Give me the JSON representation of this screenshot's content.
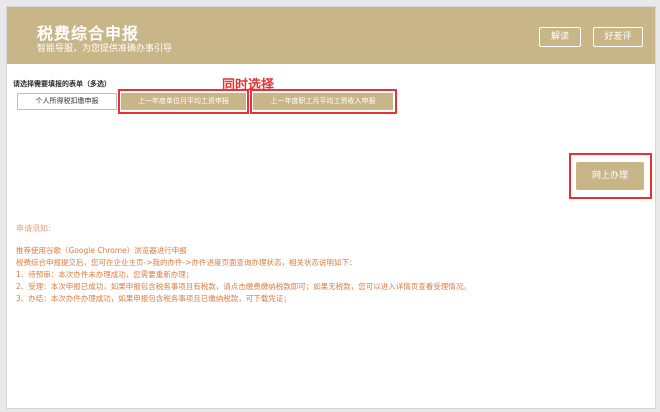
{
  "header": {
    "title": "税费综合申报",
    "subtitle": "智能导服，为您提供准确办事引导",
    "read_label": "解读",
    "rate_label": "好差评"
  },
  "annotation": {
    "text": "同时选择",
    "color": "#e63232"
  },
  "form_select": {
    "label": "请选择需要填报的表单（多选）",
    "tabs": [
      {
        "label": "个人所得税扣缴申报",
        "selected": false
      },
      {
        "label": "上一年度单位月平均工资申报",
        "selected": true
      },
      {
        "label": "上一年度职工月平均工资收入申报",
        "selected": true
      }
    ]
  },
  "actions": {
    "online_label": "网上办理"
  },
  "notice": {
    "title": "申请须知:",
    "lines": [
      "推荐使用谷歌（Google Chrome）浏览器进行申报",
      "税费综合申报提交后，您可在企业主页->我的办件->办件进度页面查询办理状态，相关状态说明如下：",
      "1、待预审：本次办件未办理成功，您需要重新办理；",
      "2、受理：本次申报已成功，如果申报包含税务事项且有税款，请点击缴费缴纳税款即可；如果无税款，您可以进入详情页查看受理情况。",
      "3、办结：本次办件办理成功，如果申报包含税务事项且已缴纳税款，可下载凭证；"
    ]
  },
  "colors": {
    "accent": "#c8b588",
    "highlight": "#e63232",
    "notice_text": "#e07b3f"
  }
}
